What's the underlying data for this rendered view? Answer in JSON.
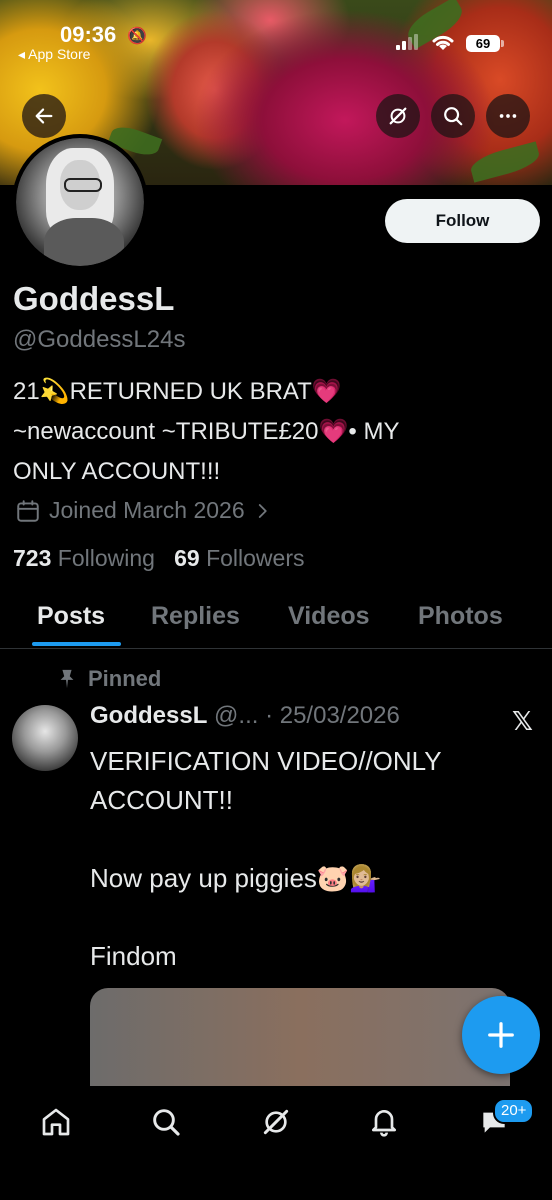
{
  "status_bar": {
    "time": "09:36",
    "back_app": "◂ App Store",
    "battery": "69"
  },
  "profile": {
    "name": "GoddessL",
    "handle": "@GoddessL24s",
    "bio": "21💫RETURNED UK BRAT💗\n~newaccount ~TRIBUTE£20💗• MY\nONLY ACCOUNT!!!",
    "joined": "Joined March 2026",
    "following_count": "723",
    "following_label": "Following",
    "followers_count": "69",
    "followers_label": "Followers",
    "follow_button": "Follow"
  },
  "tabs": [
    {
      "label": "Posts",
      "active": true
    },
    {
      "label": "Replies",
      "active": false
    },
    {
      "label": "Videos",
      "active": false
    },
    {
      "label": "Photos",
      "active": false
    }
  ],
  "pinned_post": {
    "pinned_label": "Pinned",
    "author": "GoddessL",
    "handle_truncated": "@...",
    "separator": " · ",
    "date": "25/03/2026",
    "text": "VERIFICATION VIDEO//ONLY\nACCOUNT!!\n\nNow pay up piggies🐷💁🏼‍♀️\n\nFindom"
  },
  "bottom_nav": {
    "messages_badge": "20+"
  },
  "colors": {
    "accent": "#1d9bf0",
    "background": "#000000",
    "text_primary": "#e7e9ea",
    "text_secondary": "#71767b"
  }
}
